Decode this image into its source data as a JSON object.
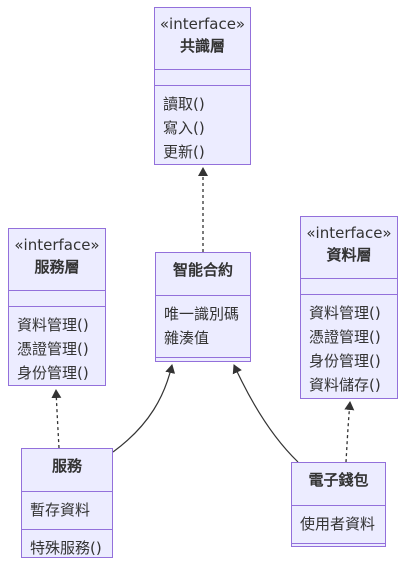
{
  "diagram": {
    "colors": {
      "fill": "#ECECFF",
      "border": "#9370DB",
      "edge": "#333333"
    },
    "classes": {
      "consensus": {
        "stereotype": "«interface»",
        "name": "共識層",
        "attributes": [],
        "methods": [
          "讀取()",
          "寫入()",
          "更新()"
        ]
      },
      "service_layer": {
        "stereotype": "«interface»",
        "name": "服務層",
        "attributes": [],
        "methods": [
          "資料管理()",
          "憑證管理()",
          "身份管理()"
        ]
      },
      "smart_contract": {
        "stereotype": "",
        "name": "智能合約",
        "attributes": [
          "唯一識別碼",
          "雜湊值"
        ],
        "methods": []
      },
      "data_layer": {
        "stereotype": "«interface»",
        "name": "資料層",
        "attributes": [],
        "methods": [
          "資料管理()",
          "憑證管理()",
          "身份管理()",
          "資料儲存()"
        ]
      },
      "service": {
        "stereotype": "",
        "name": "服務",
        "attributes": [
          "暫存資料"
        ],
        "methods": [
          "特殊服務()"
        ]
      },
      "wallet": {
        "stereotype": "",
        "name": "電子錢包",
        "attributes": [
          "使用者資料"
        ],
        "methods": []
      }
    },
    "relations": [
      {
        "from": "smart_contract",
        "to": "consensus",
        "style": "dashed",
        "kind": "realization"
      },
      {
        "from": "service",
        "to": "service_layer",
        "style": "dashed",
        "kind": "realization"
      },
      {
        "from": "service",
        "to": "smart_contract",
        "style": "solid",
        "kind": "association"
      },
      {
        "from": "wallet",
        "to": "smart_contract",
        "style": "solid",
        "kind": "association"
      },
      {
        "from": "wallet",
        "to": "data_layer",
        "style": "dashed",
        "kind": "realization"
      }
    ]
  }
}
